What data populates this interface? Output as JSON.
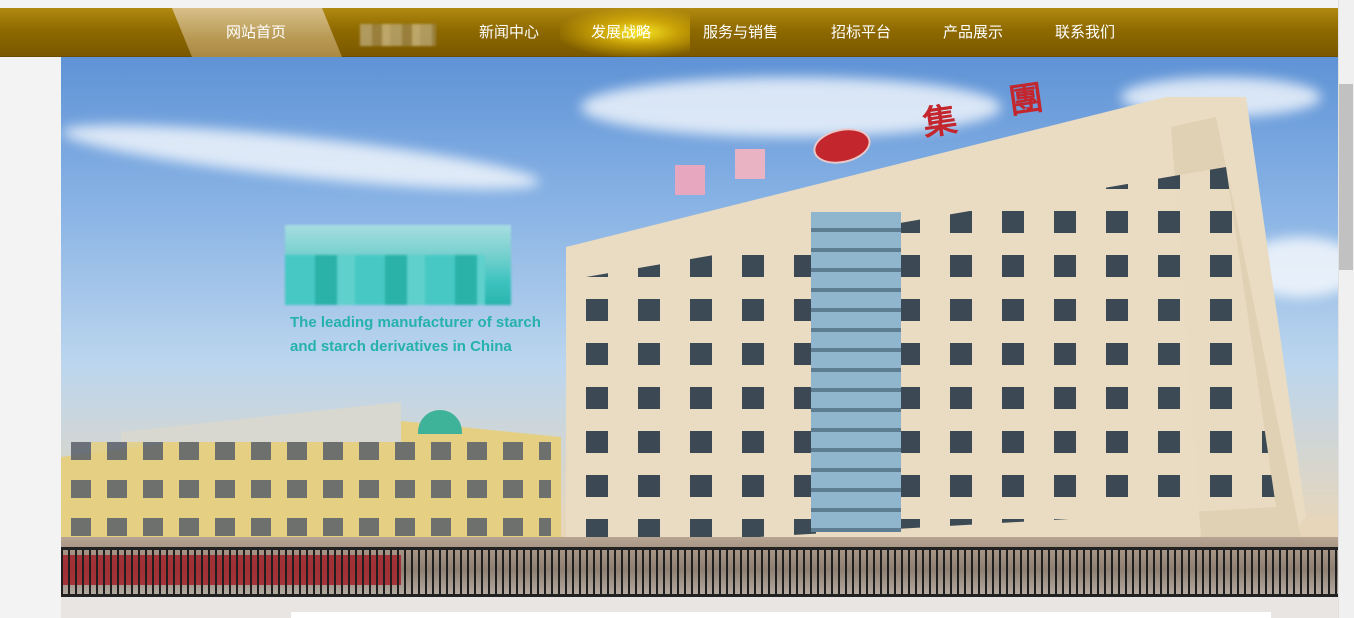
{
  "nav": {
    "items": [
      {
        "label": "网站首页",
        "active": true
      },
      {
        "label": "",
        "blurred": true
      },
      {
        "label": "新闻中心"
      },
      {
        "label": "发展战略"
      },
      {
        "label": "服务与销售"
      },
      {
        "label": "招标平台"
      },
      {
        "label": "产品展示"
      },
      {
        "label": "联系我们"
      }
    ]
  },
  "hero": {
    "tagline_line1": "The leading manufacturer of starch",
    "tagline_line2": "and starch derivatives in China",
    "sign_char_1": "集",
    "sign_char_2": "團"
  },
  "colors": {
    "nav_gold": "#8f6a00",
    "nav_active": "#b99a55",
    "tagline_teal": "#25b1ad",
    "sign_red": "#c4262e"
  }
}
